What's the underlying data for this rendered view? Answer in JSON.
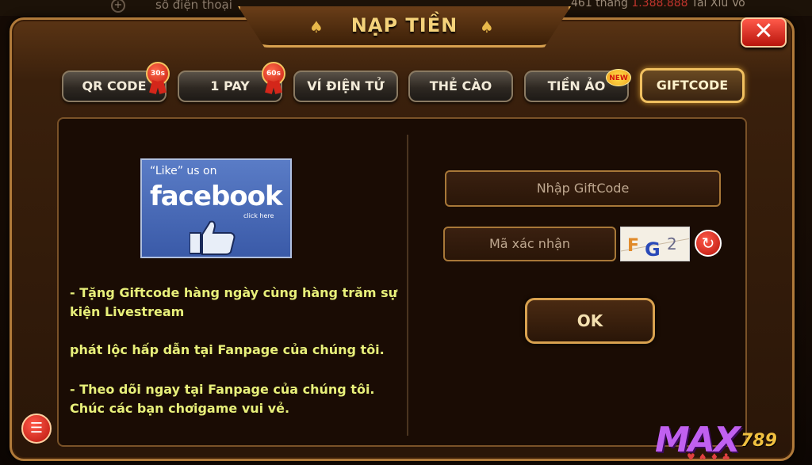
{
  "background": {
    "phone_placeholder": "số điện thoại",
    "stats_text": "461 thắng",
    "stats_amount": "1.388.888",
    "stats_suffix": "Tài Xỉu Vô"
  },
  "dialog": {
    "title": "NẠP TIỀN",
    "close_label": "✕"
  },
  "tabs": [
    {
      "label": "QR CODE",
      "badge": "30s"
    },
    {
      "label": "1 PAY",
      "badge": "60s"
    },
    {
      "label": "VÍ ĐIỆN TỬ"
    },
    {
      "label": "THẺ CÀO"
    },
    {
      "label": "TIỀN ẢO",
      "badge": "NEW"
    },
    {
      "label": "GIFTCODE",
      "active": true
    }
  ],
  "facebook": {
    "like_text": "“Like” us on",
    "brand": "facebook",
    "click_text": "click here"
  },
  "description": {
    "line1": "- Tặng Giftcode hàng ngày cùng hàng trăm sự",
    "line2": "kiện Livestream",
    "line3": "phát lộc hấp dẫn tại Fanpage của chúng tôi.",
    "line4": "- Theo dõi ngay tại Fanpage của chúng tôi.",
    "line5": "Chúc các bạn chơigame vui vẻ."
  },
  "form": {
    "giftcode_placeholder": "Nhập GiftCode",
    "captcha_placeholder": "Mã xác nhận",
    "captcha_text": "FG2",
    "ok_label": "OK"
  },
  "logo": {
    "brand": "MAX",
    "number": "789"
  },
  "colors": {
    "accent_gold": "#d8a14f",
    "desc_text": "#e8f07a",
    "close_red": "#c81e12",
    "facebook_blue": "#3a5aa8"
  }
}
